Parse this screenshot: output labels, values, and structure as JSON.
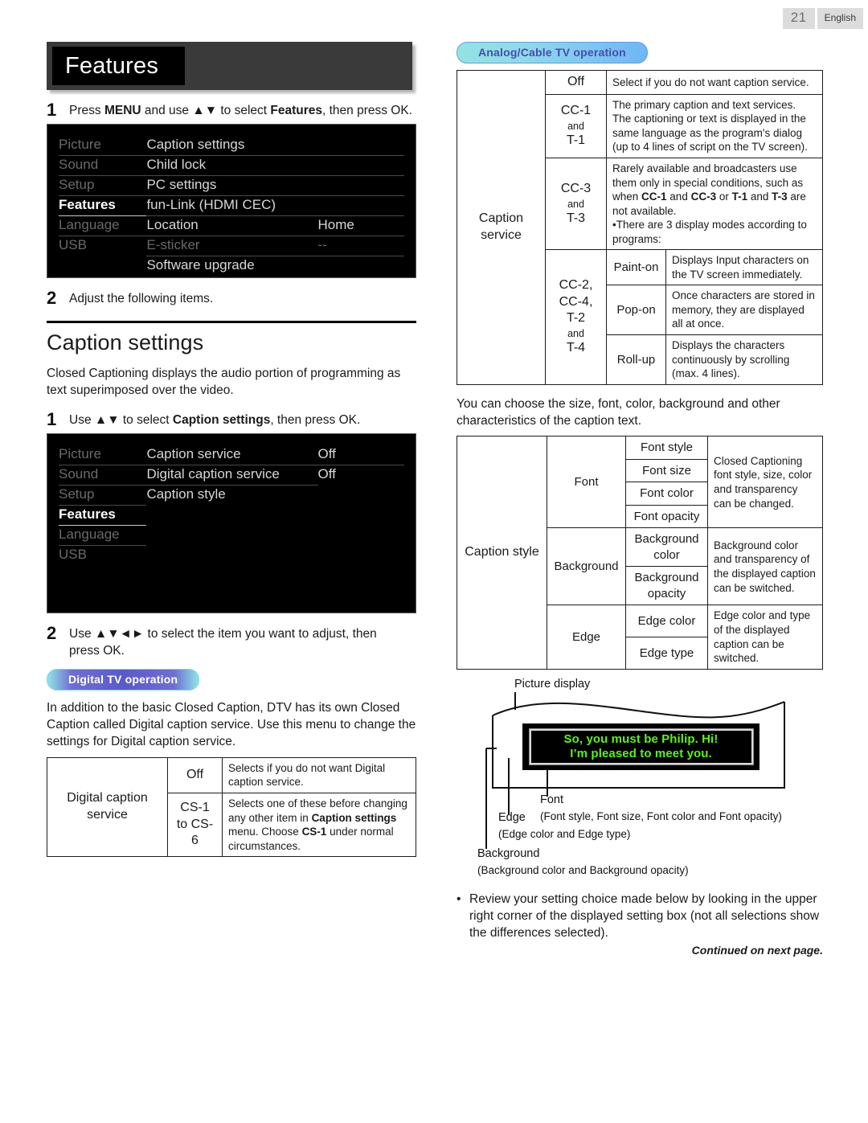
{
  "page": {
    "number": "21",
    "language": "English"
  },
  "left": {
    "feature_title": "Features",
    "step1": {
      "num": "1",
      "pre": "Press ",
      "b1": "MENU",
      "mid": " and use ▲▼ to select ",
      "b2": "Features",
      "post": ", then press OK."
    },
    "menu1": {
      "col1": [
        {
          "label": "Picture",
          "state": "dim"
        },
        {
          "label": "Sound",
          "state": "dim"
        },
        {
          "label": "Setup",
          "state": "dim"
        },
        {
          "label": "Features",
          "state": "sel"
        },
        {
          "label": "Language",
          "state": "dim"
        },
        {
          "label": "USB",
          "state": "dim"
        }
      ],
      "col2": [
        {
          "label": "Caption settings",
          "state": "bright"
        },
        {
          "label": "Child lock",
          "state": "bright"
        },
        {
          "label": "PC settings",
          "state": "bright"
        },
        {
          "label": "fun-Link (HDMI CEC)",
          "state": "bright"
        },
        {
          "label": "Location",
          "state": "bright"
        },
        {
          "label": "E-sticker",
          "state": "dim"
        },
        {
          "label": "Software upgrade",
          "state": "bright"
        }
      ],
      "col3": [
        {
          "label": "",
          "state": "bright"
        },
        {
          "label": "",
          "state": "bright"
        },
        {
          "label": "",
          "state": "bright"
        },
        {
          "label": "",
          "state": "bright"
        },
        {
          "label": "Home",
          "state": "bright"
        },
        {
          "label": "--",
          "state": "dim"
        },
        {
          "label": "",
          "state": "blank"
        }
      ]
    },
    "step2": {
      "num": "2",
      "text": "Adjust the following items."
    },
    "section_title": "Caption settings",
    "intro": "Closed Captioning displays the audio portion of programming as text superimposed over the video.",
    "step3": {
      "num": "1",
      "pre": "Use ▲▼ to select ",
      "b1": "Caption settings",
      "post": ", then press OK."
    },
    "menu2": {
      "col1": [
        {
          "label": "Picture",
          "state": "dim"
        },
        {
          "label": "Sound",
          "state": "dim"
        },
        {
          "label": "Setup",
          "state": "dim"
        },
        {
          "label": "Features",
          "state": "sel"
        },
        {
          "label": "Language",
          "state": "dim"
        },
        {
          "label": "USB",
          "state": "dim-noline"
        }
      ],
      "col2": [
        {
          "label": "Caption service",
          "state": "bright"
        },
        {
          "label": "Digital caption service",
          "state": "bright"
        },
        {
          "label": "Caption style",
          "state": "bright-noline"
        },
        {
          "label": "",
          "state": "blank"
        },
        {
          "label": "",
          "state": "blank"
        },
        {
          "label": "",
          "state": "blank"
        }
      ],
      "col3": [
        {
          "label": "Off",
          "state": "bright"
        },
        {
          "label": "Off",
          "state": "bright-noline"
        },
        {
          "label": "",
          "state": "blank"
        },
        {
          "label": "",
          "state": "blank"
        },
        {
          "label": "",
          "state": "blank"
        },
        {
          "label": "",
          "state": "blank"
        }
      ]
    },
    "step4": {
      "num": "2",
      "text": "Use ▲▼◄► to select the item you want to adjust, then press OK."
    },
    "badge_digital": "Digital TV operation",
    "dtv_intro": "In addition to the basic Closed Caption, DTV has its own Closed Caption called Digital caption service. Use this menu to change the settings for Digital caption service.",
    "dtv_table": {
      "row_label": "Digital caption service",
      "rows": [
        {
          "key": "Off",
          "desc": "Selects if you do not want Digital caption service."
        },
        {
          "key": "CS-1 to CS-6",
          "desc_parts": [
            "Selects one of these before changing any other item in ",
            "Caption settings",
            " menu. Choose ",
            "CS-1",
            " under normal circumstances."
          ]
        }
      ]
    }
  },
  "right": {
    "badge_analog": "Analog/Cable TV operation",
    "analog_table": {
      "row_label": "Caption service",
      "rows": [
        {
          "key": "Off",
          "desc": "Select if you do not want caption service."
        },
        {
          "key": "CC-1",
          "and": "and",
          "key2": "T-1",
          "desc": "The primary caption and text services. The captioning or text is displayed in the same language as the program's dialog (up to 4 lines of script on the TV screen)."
        },
        {
          "key": "CC-3",
          "and": "and",
          "key2": "T-3",
          "desc_parts": [
            "Rarely available and broadcasters use them only in special conditions, such as when ",
            "CC-1",
            " and ",
            "CC-3",
            " or ",
            "T-1",
            " and ",
            "T-3",
            " are not available."
          ],
          "bullet": "•There are 3 display modes according to programs:"
        }
      ],
      "modes_key": [
        "CC-2,",
        "CC-4,",
        "T-2",
        "and",
        "T-4"
      ],
      "modes": [
        {
          "name": "Paint-on",
          "desc": "Displays Input characters on the TV screen immediately."
        },
        {
          "name": "Pop-on",
          "desc": "Once characters are stored in memory, they are displayed all at once."
        },
        {
          "name": "Roll-up",
          "desc": "Displays the characters continuously by scrolling (max. 4 lines)."
        }
      ]
    },
    "style_intro": "You can choose the size, font, color, background and other characteristics of the caption text.",
    "style_table": {
      "row_label": "Caption style",
      "groups": [
        {
          "name": "Font",
          "items": [
            "Font style",
            "Font size",
            "Font color",
            "Font opacity"
          ],
          "desc": "Closed Captioning font style, size, color and transparency can be changed."
        },
        {
          "name": "Background",
          "items": [
            "Background color",
            "Background opacity"
          ],
          "desc": "Background color and transparency of the displayed caption can be switched."
        },
        {
          "name": "Edge",
          "items": [
            "Edge color",
            "Edge type"
          ],
          "desc": "Edge color and type of the displayed caption can be switched."
        }
      ]
    },
    "diagram": {
      "picture_display": "Picture display",
      "caption_line1": "So, you must be Philip. Hi!",
      "caption_line2": "I’m pleased to meet you.",
      "font_label": "Font",
      "font_sub": "(Font style, Font size, Font color and Font opacity)",
      "edge_label": "Edge",
      "edge_sub": "(Edge color and Edge type)",
      "background_label": "Background",
      "background_sub": "(Background color and Background opacity)"
    },
    "bullet": "Review your setting choice made below by looking in the upper right corner of the displayed setting box (not all selections show the differences selected).",
    "continued": "Continued on next page."
  }
}
